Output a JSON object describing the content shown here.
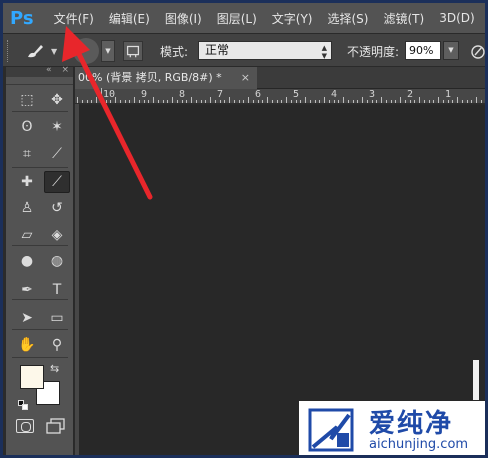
{
  "app": {
    "logo": "Ps"
  },
  "menubar": {
    "items": [
      "文件(F)",
      "编辑(E)",
      "图像(I)",
      "图层(L)",
      "文字(Y)",
      "选择(S)",
      "滤镜(T)",
      "3D(D)"
    ]
  },
  "options": {
    "mode_label": "模式:",
    "mode_value": "正常",
    "opacity_label": "不透明度:",
    "opacity_value": "90%"
  },
  "document": {
    "tab_label": "00% (背景 拷贝, RGB/8#) *",
    "close": "×"
  },
  "ruler": {
    "labels": [
      "10",
      "9",
      "8",
      "7",
      "6",
      "5",
      "4",
      "3",
      "2",
      "1"
    ]
  },
  "tools": {
    "items": [
      {
        "name": "marquee-tool",
        "glyph": "⬚"
      },
      {
        "name": "move-tool",
        "glyph": "✥"
      },
      {
        "name": "lasso-tool",
        "glyph": "ʘ"
      },
      {
        "name": "magic-wand-tool",
        "glyph": "✶"
      },
      {
        "name": "crop-tool",
        "glyph": "⌗"
      },
      {
        "name": "eyedropper-tool",
        "glyph": "⟋"
      },
      {
        "name": "healing-brush-tool",
        "glyph": "✚"
      },
      {
        "name": "brush-tool",
        "glyph": "⟋"
      },
      {
        "name": "clone-stamp-tool",
        "glyph": "♙"
      },
      {
        "name": "history-brush-tool",
        "glyph": "↺"
      },
      {
        "name": "eraser-tool",
        "glyph": "▱"
      },
      {
        "name": "paint-bucket-tool",
        "glyph": "◈"
      },
      {
        "name": "blur-tool",
        "glyph": "●"
      },
      {
        "name": "dodge-tool",
        "glyph": "◍"
      },
      {
        "name": "pen-tool",
        "glyph": "✒"
      },
      {
        "name": "type-tool",
        "glyph": "T"
      },
      {
        "name": "path-selection-tool",
        "glyph": "➤"
      },
      {
        "name": "rectangle-tool",
        "glyph": "▭"
      },
      {
        "name": "hand-tool",
        "glyph": "✋"
      },
      {
        "name": "zoom-tool",
        "glyph": "⚲"
      }
    ],
    "swap_glyph": "⇆",
    "foreground_color": "#fdf8ea",
    "background_color": "#ffffff"
  },
  "watermark": {
    "name": "爱纯净",
    "url": "aichunjing.com"
  },
  "colors": {
    "accent": "#31a8ff",
    "arrow": "#e8262b",
    "watermark": "#1f4aa8"
  }
}
